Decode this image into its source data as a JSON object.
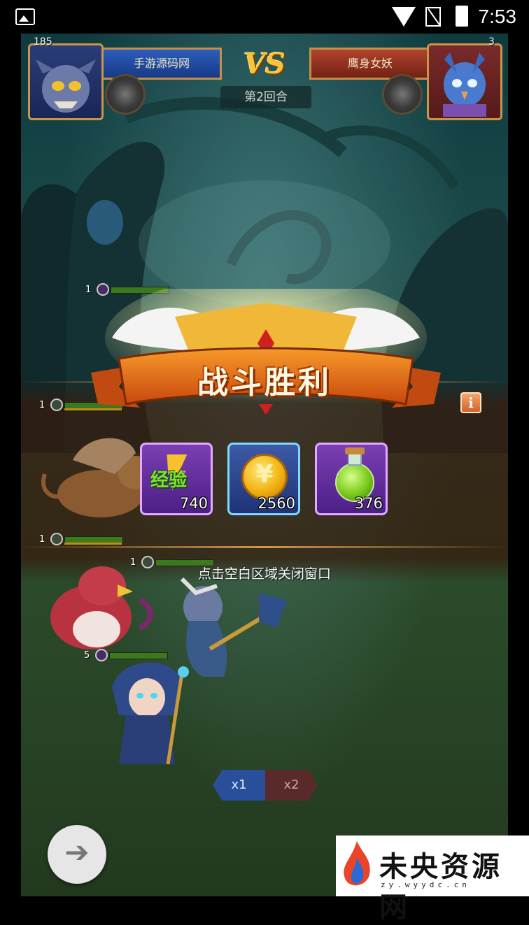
{
  "status_bar": {
    "time": "7:53"
  },
  "hud": {
    "player": {
      "name": "手游源码网",
      "level": "185"
    },
    "vs": "VS",
    "round": "第2回合",
    "enemy": {
      "name": "鹰身女妖",
      "level": "3"
    }
  },
  "units": {
    "enemy_top_level": "1",
    "enemy_griffin_level": "1",
    "ally_bird_level": "1",
    "ally_warrior_level": "1",
    "ally_mage_level": "5"
  },
  "victory": {
    "title": "战斗胜利",
    "rewards": [
      {
        "icon": "exp-icon",
        "label": "经验",
        "quantity": "740"
      },
      {
        "icon": "gold-coin-icon",
        "label": "",
        "quantity": "2560"
      },
      {
        "icon": "green-potion-icon",
        "label": "",
        "quantity": "376"
      }
    ],
    "hint": "点击空白区域关闭窗口",
    "info_icon": "i"
  },
  "speed": {
    "x1": "x1",
    "x2": "x2"
  },
  "watermark": {
    "title": "未央资源网",
    "url": "zy.wyydc.cn"
  },
  "colors": {
    "victory_banner": "#e2721d",
    "player_panel": "#2c5dbb",
    "enemy_panel": "#b1432c",
    "vs": "#f7c437"
  }
}
